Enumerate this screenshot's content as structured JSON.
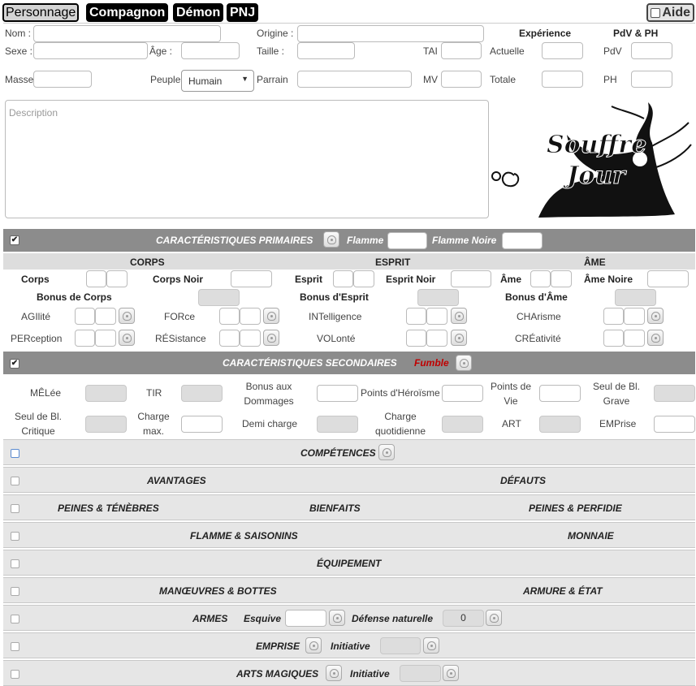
{
  "tabs": [
    "Personnage",
    "Compagnon",
    "Démon",
    "PNJ"
  ],
  "aide": "Aide",
  "identity": {
    "nom": "Nom :",
    "origine": "Origine :",
    "sexe": "Sexe :",
    "age": "Âge :",
    "taille": "Taille :",
    "tai": "TAI",
    "masse": "Masse",
    "peuple": "Peuple",
    "peuple_value": "Humain",
    "parrain": "Parrain",
    "mv": "MV",
    "experience": "Expérience",
    "pdv_ph": "PdV & PH",
    "actuelle": "Actuelle",
    "totale": "Totale",
    "pdv": "PdV",
    "ph": "PH",
    "description_placeholder": "Description"
  },
  "logo": {
    "line1": "Souffre",
    "line2": "Jour"
  },
  "primaires": {
    "title": "CARACTÉRISTIQUES PRIMAIRES",
    "flamme": "Flamme",
    "flamme_noire": "Flamme Noire",
    "corps": "CORPS",
    "esprit": "ESPRIT",
    "ame": "ÂME",
    "corps_l": "Corps",
    "corps_noir": "Corps Noir",
    "esprit_l": "Esprit",
    "esprit_noir": "Esprit Noir",
    "ame_l": "Âme",
    "ame_noire": "Âme Noire",
    "bonus_corps": "Bonus de Corps",
    "bonus_esprit": "Bonus d'Esprit",
    "bonus_ame": "Bonus d'Âme",
    "agi": "AGIlité",
    "for": "FORce",
    "int": "INTelligence",
    "cha": "CHArisme",
    "per": "PERception",
    "res": "RÉSistance",
    "vol": "VOLonté",
    "cre": "CRÉativité"
  },
  "secondaires": {
    "title": "CARACTÉRISTIQUES SECONDAIRES",
    "fumble": "Fumble",
    "melee": "MÊLée",
    "tir": "TIR",
    "bonus_dommages": "Bonus aux Dommages",
    "points_heroisme": "Points d'Héroïsme",
    "points_vie": "Points de Vie",
    "seuil_grave": "Seul de Bl. Grave",
    "seuil_critique": "Seul de Bl. Critique",
    "charge_max": "Charge max.",
    "demi_charge": "Demi charge",
    "charge_quot": "Charge quotidienne",
    "art": "ART",
    "emprise": "EMPrise"
  },
  "sections": {
    "competences": "COMPÉTENCES",
    "avantages": "AVANTAGES",
    "defauts": "DÉFAUTS",
    "peines_tenebres": "PEINES & TÉNÈBRES",
    "bienfaits": "BIENFAITS",
    "peines_perfidie": "PEINES & PERFIDIE",
    "flamme_saisonins": "FLAMME & SAISONINS",
    "monnaie": "MONNAIE",
    "equipement": "ÉQUIPEMENT",
    "manoeuvres": "MANŒUVRES & BOTTES",
    "armure": "ARMURE & ÉTAT",
    "armes": "ARMES",
    "esquive": "Esquive",
    "defense_nat": "Défense naturelle",
    "defense_value": "0",
    "emprise": "EMPRISE",
    "initiative": "Initiative",
    "arts": "ARTS MAGIQUES"
  },
  "colors": {
    "bar": "#8c8c8c",
    "fumble": "#c00000",
    "section": "#e6e6e6"
  }
}
